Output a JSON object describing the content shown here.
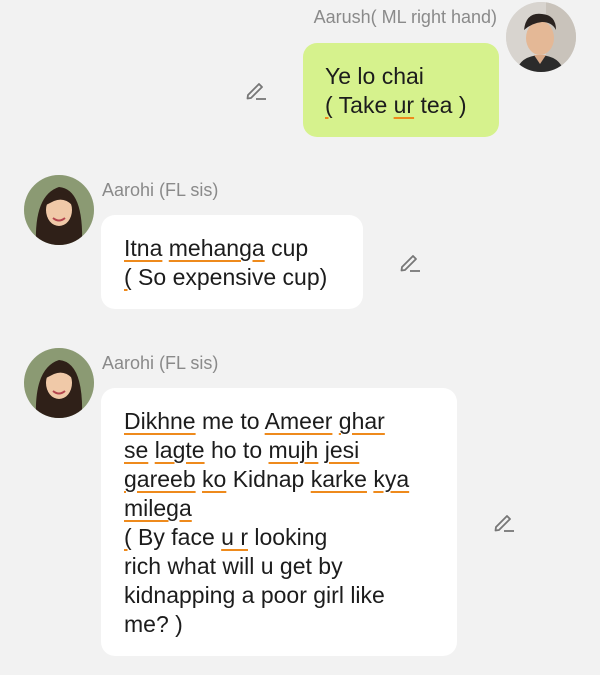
{
  "messages": [
    {
      "sender": "Aarush( ML right hand)",
      "side": "right",
      "lines": [
        "Ye lo chai",
        "( Take ur tea )"
      ]
    },
    {
      "sender": "Aarohi (FL sis)",
      "side": "left",
      "lines": [
        "Itna mehanga cup",
        "( So expensive cup)"
      ]
    },
    {
      "sender": "Aarohi (FL sis)",
      "side": "left",
      "lines": [
        "Dikhne me to Ameer ghar",
        "se lagte ho to mujh jesi",
        "gareeb ko Kidnap karke kya",
        "milega",
        "( By face u r looking",
        "rich what will u get by",
        "kidnapping a poor girl like",
        "me? )"
      ]
    }
  ],
  "icons": {
    "edit": "pencil-edit-icon",
    "avatar_male": "avatar-aarush",
    "avatar_female": "avatar-aarohi"
  },
  "colors": {
    "background": "#f2f2f2",
    "mine_bubble": "#d6f28d",
    "their_bubble": "#ffffff",
    "spellcheck_underline": "#ee8a1c"
  }
}
